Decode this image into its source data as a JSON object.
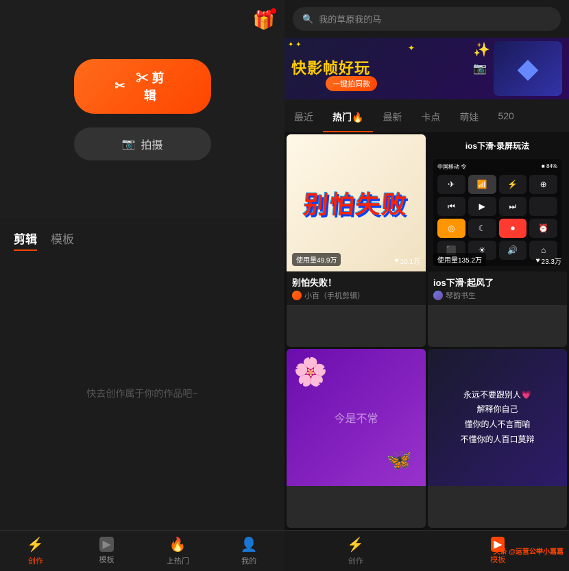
{
  "left": {
    "gift_icon": "🎁",
    "edit_button": "✂ 剪辑",
    "shoot_button": "📷 拍摄",
    "tabs": [
      "剪辑",
      "模板"
    ],
    "active_tab": "剪辑",
    "empty_hint": "快去创作属于你的作品吧~",
    "bottom_nav": [
      {
        "icon": "⚡",
        "label": "创作",
        "active": true
      },
      {
        "icon": "▶",
        "label": "模板",
        "active": false
      },
      {
        "icon": "🔥",
        "label": "上热门",
        "active": false
      },
      {
        "icon": "👤",
        "label": "我的",
        "active": false
      }
    ]
  },
  "right": {
    "search_placeholder": "我的草原我的马",
    "banner": {
      "title": "快影帧好玩",
      "badge": "一键拍同款",
      "diamond_icon": "◆"
    },
    "tabs": [
      "最近",
      "热门🔥",
      "最新",
      "卡点",
      "萌娃",
      "520"
    ],
    "active_tab": "热门🔥",
    "videos": [
      {
        "id": "v1",
        "title": "别怕失败！",
        "author": "小百（手机剪辑）",
        "usage": "使用量49.9万",
        "likes": "10.1万",
        "thumb_type": "text",
        "thumb_text": "别怕失败"
      },
      {
        "id": "v2",
        "title": "ios下滑·起风了",
        "author": "琴韵书生",
        "usage": "使用量135.2万",
        "likes": "23.3万",
        "thumb_type": "ios",
        "thumb_label": "ios下滑·录屏玩法"
      },
      {
        "id": "v3",
        "title": "",
        "author": "",
        "usage": "",
        "likes": "",
        "thumb_type": "purple"
      },
      {
        "id": "v4",
        "title": "",
        "author": "",
        "usage": "",
        "likes": "",
        "thumb_type": "quote",
        "quote": "永远不要跟别人\n解释你自己\n懂你的人不言而喻\n不懂你的人百口莫辩"
      }
    ],
    "bottom_nav": [
      {
        "icon": "⚡",
        "label": "创作",
        "active": false
      },
      {
        "icon": "▶",
        "label": "模板",
        "active": true
      },
      {
        "icon": "头条",
        "label": "头条 @运营公举小嘉嘉",
        "active": false,
        "is_watermark": true
      }
    ],
    "watermark": "头条 @运营公举小嘉嘉"
  }
}
